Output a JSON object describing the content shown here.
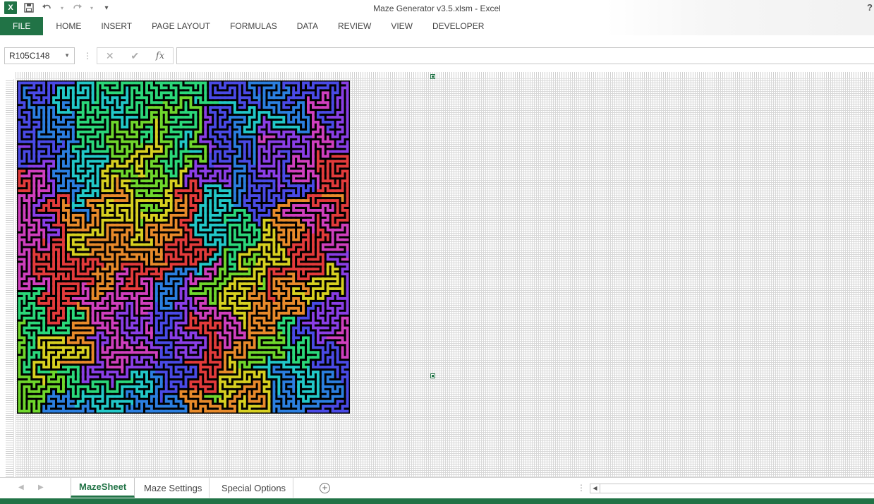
{
  "window": {
    "title": "Maze Generator v3.5.xlsm - Excel",
    "help_label": "?"
  },
  "qat": {
    "app_icon": "excel-icon",
    "app_label": "X",
    "save_icon": "save-icon",
    "undo_icon": "undo-icon",
    "redo_icon": "redo-icon",
    "customize_icon": "customize-qat-icon"
  },
  "ribbon": {
    "tabs": [
      {
        "label": "FILE"
      },
      {
        "label": "HOME"
      },
      {
        "label": "INSERT"
      },
      {
        "label": "PAGE LAYOUT"
      },
      {
        "label": "FORMULAS"
      },
      {
        "label": "DATA"
      },
      {
        "label": "REVIEW"
      },
      {
        "label": "VIEW"
      },
      {
        "label": "DEVELOPER"
      }
    ]
  },
  "formula_bar": {
    "name_box": "R105C148",
    "cancel_glyph": "✕",
    "enter_glyph": "✔",
    "fx_label": "fx",
    "formula": ""
  },
  "sheet": {
    "maze": {
      "cells": 68,
      "colors": [
        "#e33b3b",
        "#e88a2a",
        "#d7d020",
        "#6fd72c",
        "#2bd87a",
        "#22c8c8",
        "#2b7fe0",
        "#4a4ae6",
        "#8a3ee6",
        "#d03fbe"
      ]
    }
  },
  "sheet_tabs": {
    "tabs": [
      {
        "label": "MazeSheet",
        "active": true
      },
      {
        "label": "Maze Settings",
        "active": false
      },
      {
        "label": "Special Options",
        "active": false
      }
    ],
    "add_label": "+"
  },
  "colors": {
    "accent": "#217346"
  }
}
